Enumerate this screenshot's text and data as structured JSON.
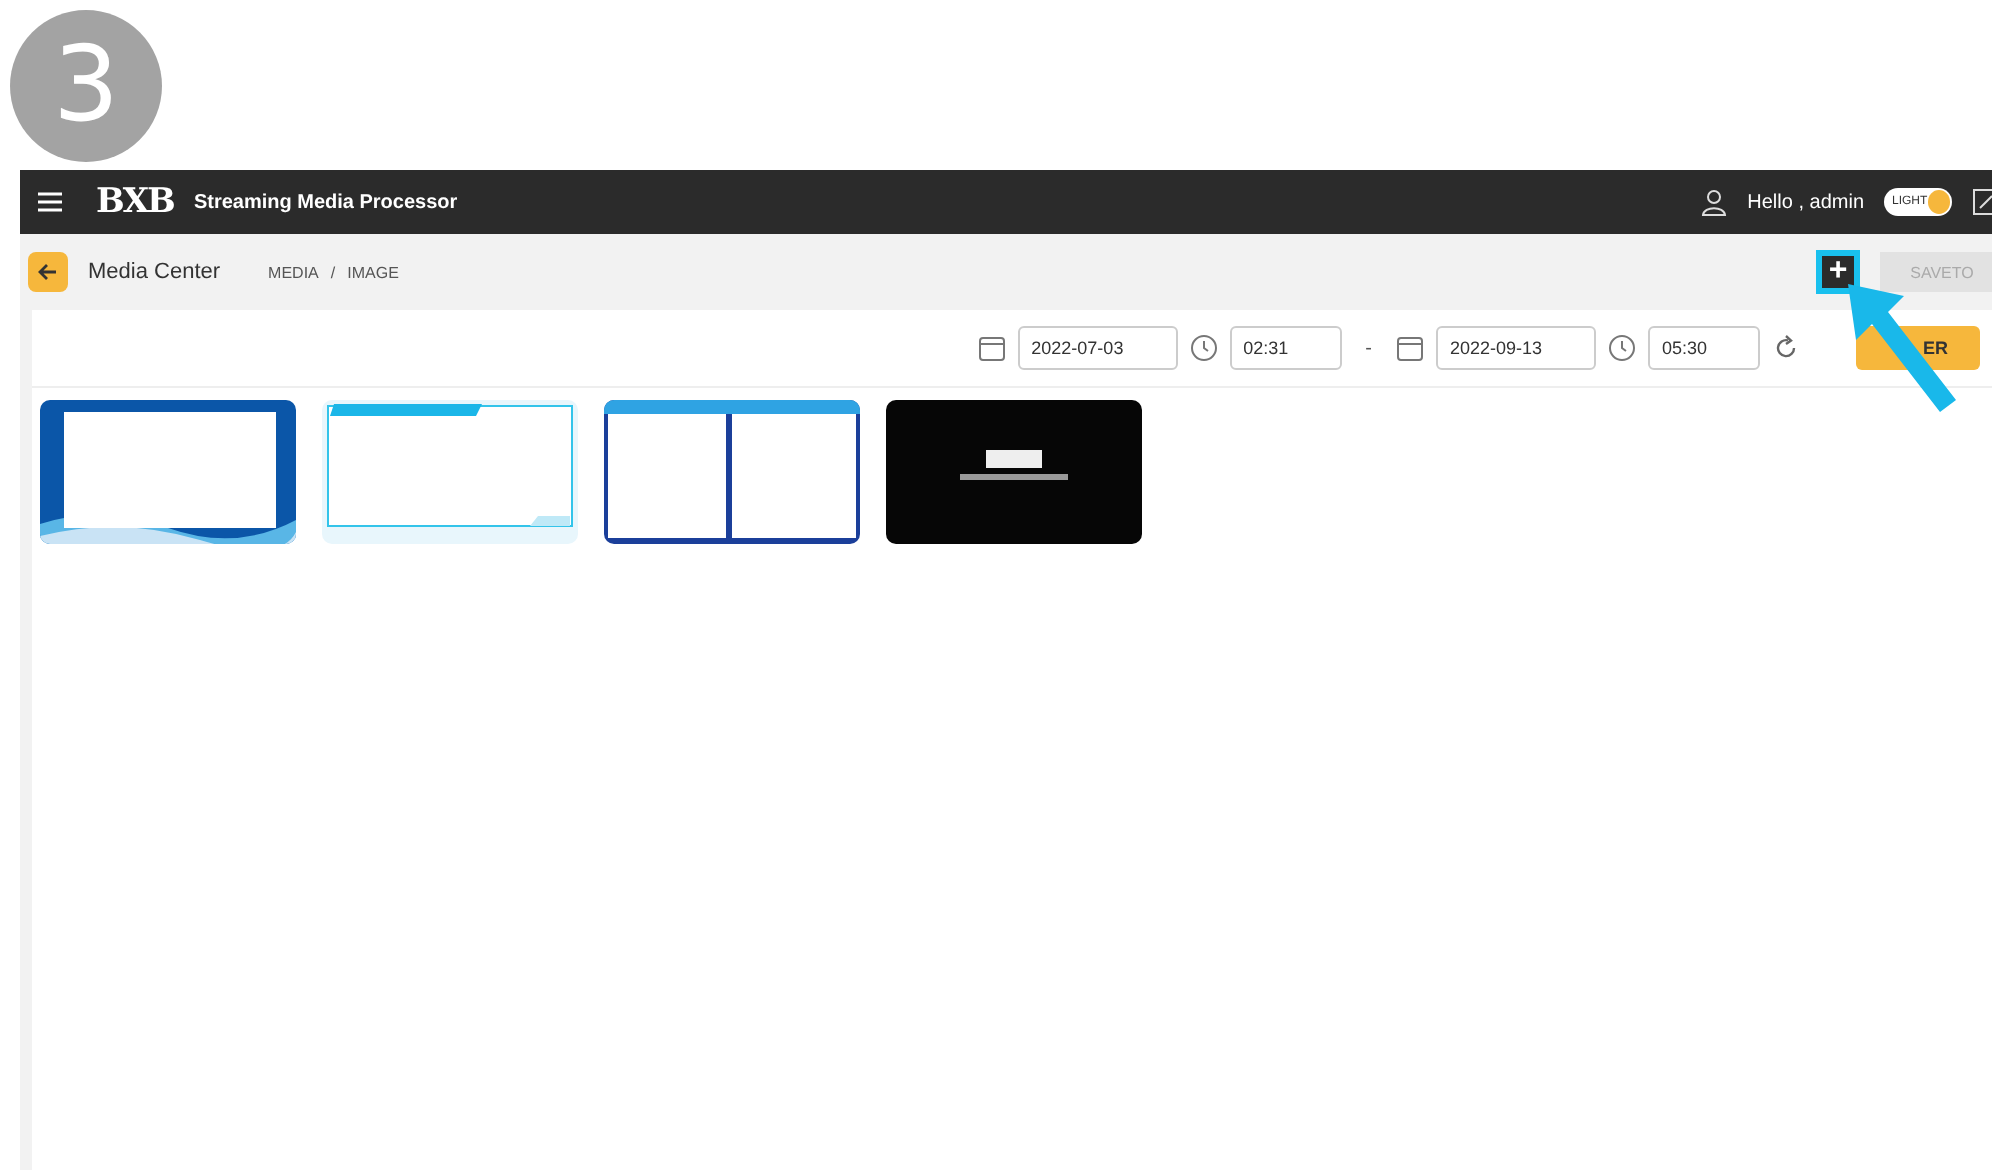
{
  "step_marker": "3",
  "header": {
    "logo": "BXB",
    "title": "Streaming Media Processor",
    "greeting": "Hello , admin",
    "theme_toggle": {
      "label": "LIGHT",
      "on": true
    }
  },
  "subheader": {
    "page_title": "Media Center",
    "breadcrumb": [
      "MEDIA",
      "IMAGE"
    ],
    "breadcrumb_separator": "/",
    "add_button": {
      "label": "+",
      "highlighted": true
    },
    "save_button": {
      "label": "SAVETO",
      "disabled": true
    }
  },
  "filter": {
    "start_date": "2022-07-03",
    "start_time": "02:31",
    "separator": "-",
    "end_date": "2022-09-13",
    "end_time": "05:30",
    "filter_button": "ER"
  }
}
